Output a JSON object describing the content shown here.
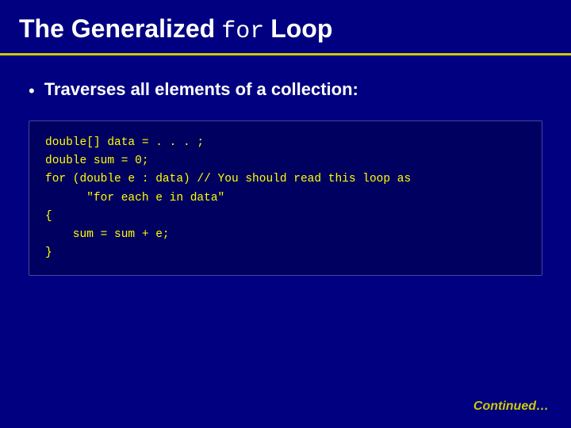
{
  "header": {
    "title_part1": "The Generalized",
    "title_code": "for",
    "title_part2": "Loop"
  },
  "bullet": {
    "text": "Traverses all elements of a collection:"
  },
  "code": {
    "lines": [
      "double[] data = . . . ;",
      "double sum = 0;",
      "for (double e : data) // You should read this loop as",
      "      \"for each e in data\"",
      "{",
      "    sum = sum + e;",
      "}"
    ]
  },
  "footer": {
    "continued": "Continued…"
  }
}
